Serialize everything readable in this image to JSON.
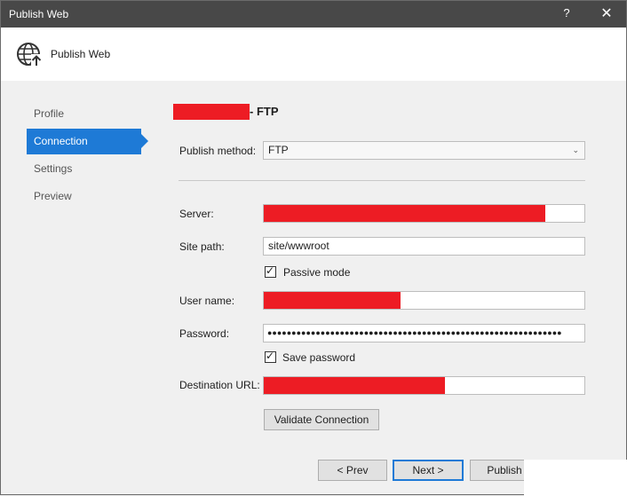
{
  "window": {
    "title": "Publish Web",
    "help_glyph": "?",
    "close_glyph": "✕"
  },
  "header": {
    "title": "Publish Web",
    "icon": "globe-publish-icon"
  },
  "nav": {
    "items": [
      {
        "label": "Profile",
        "active": false
      },
      {
        "label": "Connection",
        "active": true
      },
      {
        "label": "Settings",
        "active": false
      },
      {
        "label": "Preview",
        "active": false
      }
    ]
  },
  "profile": {
    "suffix": "- FTP"
  },
  "form": {
    "publish_method_label": "Publish method:",
    "publish_method_value": "FTP",
    "server_label": "Server:",
    "site_path_label": "Site path:",
    "site_path_value": "site/wwwroot",
    "passive_mode_label": "Passive mode",
    "passive_mode_checked": true,
    "user_name_label": "User name:",
    "password_label": "Password:",
    "password_value": "●●●●●●●●●●●●●●●●●●●●●●●●●●●●●●●●●●●●●●●●●●●●●●●●●●●●●●●●●●●●●",
    "save_password_label": "Save password",
    "save_password_checked": true,
    "destination_url_label": "Destination URL:",
    "validate_button": "Validate Connection"
  },
  "footer": {
    "prev_button": "< Prev",
    "next_button": "Next >",
    "publish_button": "Publish"
  },
  "colors": {
    "accent": "#1e7ad6",
    "redaction": "#ed1c24",
    "titlebar": "#484848"
  }
}
